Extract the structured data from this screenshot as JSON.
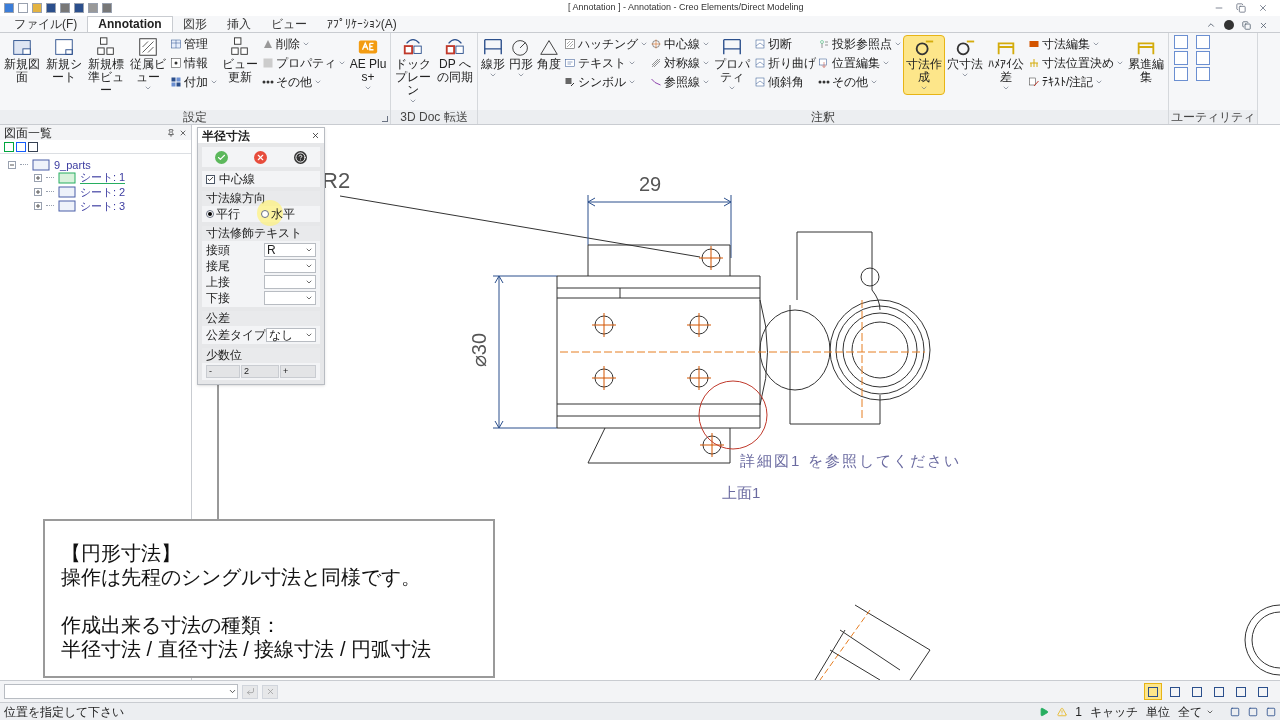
{
  "window": {
    "title": "[ Annotation ] - Annotation - Creo Elements/Direct Modeling"
  },
  "tabs": [
    {
      "label": "ファイル(F)",
      "selected": false
    },
    {
      "label": "Annotation",
      "selected": true
    },
    {
      "label": "図形",
      "selected": false
    },
    {
      "label": "挿入",
      "selected": false
    },
    {
      "label": "ビュー",
      "selected": false
    },
    {
      "label": "ｱﾌﾟﾘｹｰｼｮﾝ(A)",
      "selected": false
    }
  ],
  "ribbon": {
    "groups": [
      {
        "label": "設定",
        "launcher": true,
        "columns": [
          {
            "kind": "large",
            "label": "新規図面",
            "active": false
          },
          {
            "kind": "large",
            "label": "新規シート",
            "active": false
          },
          {
            "kind": "large",
            "label": "新規標準ビュー",
            "active": false
          },
          {
            "kind": "large",
            "label": "従属ビュー",
            "dropdown": true,
            "active": false
          },
          {
            "kind": "stack",
            "items": [
              {
                "label": "管理"
              },
              {
                "label": "情報"
              },
              {
                "label": "付加",
                "dropdown": true
              }
            ]
          },
          {
            "kind": "large",
            "label": "ビュー更新",
            "active": false
          },
          {
            "kind": "stack",
            "items": [
              {
                "label": "削除",
                "dropdown": true
              },
              {
                "label": "プロパティ",
                "dropdown": true
              },
              {
                "label": "その他",
                "dropdown": true
              }
            ]
          },
          {
            "kind": "large",
            "label": "AE Plus+",
            "dropdown": true,
            "active": false
          }
        ]
      },
      {
        "label": "3D Doc 転送",
        "columns": [
          {
            "kind": "large",
            "label": "ドックプレーン",
            "dropdown": true,
            "active": false
          },
          {
            "kind": "large",
            "label": "DP への同期",
            "active": false
          }
        ]
      },
      {
        "label": "注釈",
        "columns": [
          {
            "kind": "large",
            "label": "線形",
            "dropdown": true,
            "active": false
          },
          {
            "kind": "large",
            "label": "円形",
            "dropdown": true,
            "active": false
          },
          {
            "kind": "large",
            "label": "角度",
            "active": false
          },
          {
            "kind": "stack",
            "items": [
              {
                "label": "ハッチング",
                "dropdown": true
              },
              {
                "label": "テキスト",
                "dropdown": true
              },
              {
                "label": "シンボル",
                "dropdown": true
              }
            ]
          },
          {
            "kind": "stack",
            "items": [
              {
                "label": "中心線",
                "dropdown": true
              },
              {
                "label": "対称線",
                "dropdown": true
              },
              {
                "label": "参照線",
                "dropdown": true
              }
            ]
          },
          {
            "kind": "large",
            "label": "プロパティ",
            "dropdown": true,
            "active": false
          },
          {
            "kind": "stack",
            "items": [
              {
                "label": "切断"
              },
              {
                "label": "折り曲げ"
              },
              {
                "label": "傾斜角"
              }
            ]
          },
          {
            "kind": "stack",
            "items": [
              {
                "label": "投影参照点",
                "dropdown": true
              },
              {
                "label": "位置編集",
                "dropdown": true
              },
              {
                "label": "その他",
                "dropdown": true
              }
            ]
          },
          {
            "kind": "large",
            "label": "寸法作成",
            "dropdown": true,
            "active": true
          },
          {
            "kind": "large",
            "label": "穴寸法",
            "dropdown": true,
            "active": false
          },
          {
            "kind": "large",
            "label": "ﾊﾒｱｲ公差",
            "dropdown": true,
            "active": false
          },
          {
            "kind": "stack",
            "items": [
              {
                "label": "寸法編集",
                "dropdown": true
              },
              {
                "label": "寸法位置決め",
                "dropdown": true
              },
              {
                "label": "ﾃｷｽﾄ/注記",
                "dropdown": true
              }
            ]
          },
          {
            "kind": "large",
            "label": "累進編集",
            "active": false
          }
        ]
      },
      {
        "label": "ユーティリティ",
        "columns": [
          {
            "kind": "iconstack"
          },
          {
            "kind": "iconstack"
          }
        ]
      }
    ]
  },
  "drawing_list": {
    "title": "図面一覧",
    "tree": [
      {
        "label": "9_parts",
        "expanded": true,
        "selected": false,
        "children": [
          {
            "label": "シート: 1",
            "expanded": false,
            "selected": true
          },
          {
            "label": "シート: 2",
            "expanded": false,
            "selected": false
          },
          {
            "label": "シート: 3",
            "expanded": false,
            "selected": false
          }
        ]
      }
    ]
  },
  "dialog": {
    "title": "半径寸法",
    "centerline": {
      "label": "中心線",
      "checked": true
    },
    "sections": [
      {
        "kind": "radio",
        "title": "寸法線方向",
        "options": [
          {
            "label": "平行",
            "selected": true
          },
          {
            "label": "水平",
            "selected": false
          }
        ]
      },
      {
        "kind": "fields",
        "title": "寸法修飾テキスト",
        "fields": [
          {
            "label": "接頭",
            "value": "R"
          },
          {
            "label": "接尾"
          },
          {
            "label": "上接"
          },
          {
            "label": "下接"
          }
        ]
      },
      {
        "kind": "fields",
        "title": "公差",
        "fields": [
          {
            "label": "公差タイプ",
            "value": "なし"
          }
        ]
      },
      {
        "kind": "stepper",
        "title": "少数位",
        "minus": "-",
        "value": "2",
        "plus": "+"
      }
    ]
  },
  "drawing": {
    "labels": [
      {
        "kind": "leader",
        "text": "R2"
      },
      {
        "kind": "dim",
        "text": "29"
      },
      {
        "kind": "vdim",
        "text": "⌀30"
      },
      {
        "kind": "note",
        "text": "詳細図1 を参照してください"
      },
      {
        "kind": "view",
        "text": "上面1"
      }
    ]
  },
  "caption": {
    "paragraphs": [
      [
        "【円形寸法】",
        "操作は先程のシングル寸法と同様です。"
      ],
      [
        "作成出来る寸法の種類：",
        "半径寸法 / 直径寸法 / 接線寸法 / 円弧寸法"
      ]
    ]
  },
  "view_toggles": [
    {
      "active": true
    },
    {
      "active": false
    },
    {
      "active": false
    },
    {
      "active": false
    },
    {
      "active": false
    },
    {
      "active": false
    }
  ],
  "status_bar": {
    "prompt": "位置を指定して下さい",
    "count": "1",
    "catch": "キャッチ",
    "unit": "単位",
    "filter": "全て"
  }
}
